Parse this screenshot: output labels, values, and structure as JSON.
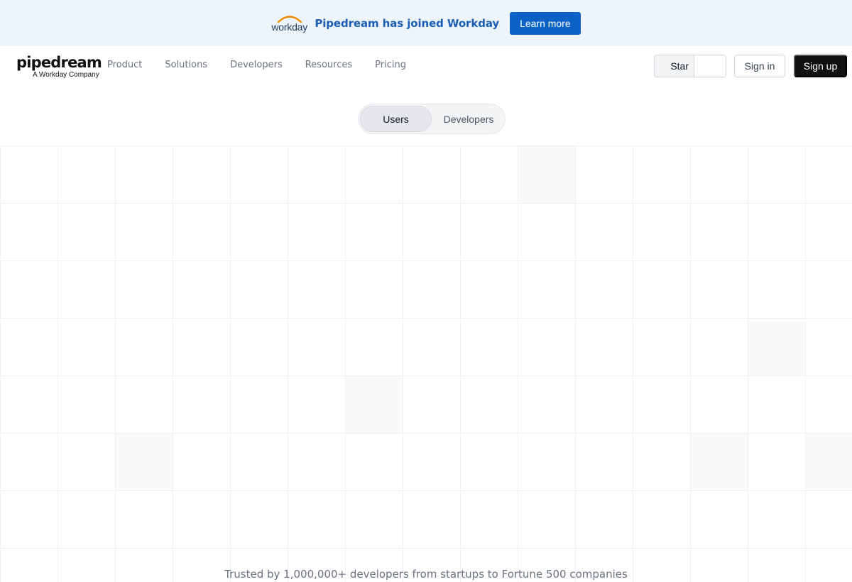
{
  "banner": {
    "logo_text": "workday",
    "message": "Pipedream has joined Workday",
    "cta_label": "Learn more"
  },
  "nav": {
    "logo": "pipedream",
    "logo_tagline": "A Workday Company",
    "links": [
      "Product",
      "Solutions",
      "Developers",
      "Resources",
      "Pricing"
    ],
    "star_label": "Star",
    "signin_label": "Sign in",
    "signup_label": "Sign up"
  },
  "toggle": {
    "options": [
      "Users",
      "Developers"
    ],
    "selected": "Users"
  },
  "hero": {
    "trusted_text": "Trusted by 1,000,000+ developers from startups to Fortune 500 companies"
  },
  "colors": {
    "banner_bg": "#eef4fb",
    "brand_blue": "#0b62c4",
    "workday_orange": "#f38b00",
    "grid_line": "#eef0f3"
  }
}
